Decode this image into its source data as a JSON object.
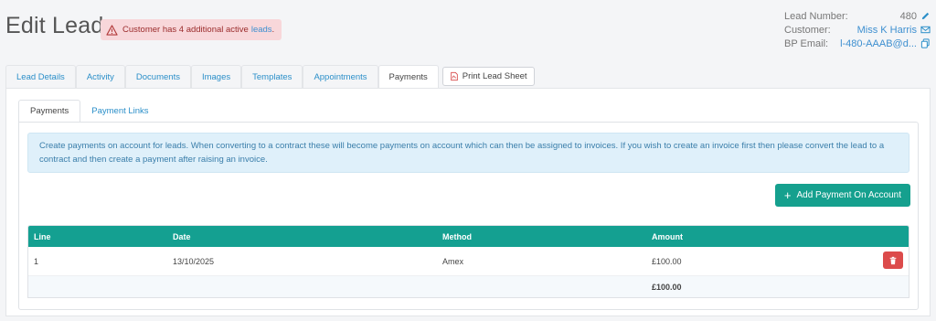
{
  "header": {
    "title": "Edit Lead",
    "alert_text": "Customer has 4 additional active",
    "alert_link": "leads",
    "alert_period": "."
  },
  "meta": {
    "lead_number_label": "Lead Number:",
    "lead_number_value": "480",
    "customer_label": "Customer:",
    "customer_value": "Miss K Harris",
    "bp_email_label": "BP Email:",
    "bp_email_value": "l-480-AAAB@d..."
  },
  "tabs": [
    {
      "label": "Lead Details"
    },
    {
      "label": "Activity"
    },
    {
      "label": "Documents"
    },
    {
      "label": "Images"
    },
    {
      "label": "Templates"
    },
    {
      "label": "Appointments"
    },
    {
      "label": "Payments"
    }
  ],
  "print_button": "Print Lead Sheet",
  "subtabs": [
    {
      "label": "Payments"
    },
    {
      "label": "Payment Links"
    }
  ],
  "info_text": "Create payments on account for leads. When converting to a contract these will become payments on account which can then be assigned to invoices. If you wish to create an invoice first then please convert the lead to a contract and then create a payment after raising an invoice.",
  "add_button": "Add Payment On Account",
  "table": {
    "headers": [
      "Line",
      "Date",
      "Method",
      "Amount"
    ],
    "rows": [
      {
        "line": "1",
        "date": "13/10/2025",
        "method": "Amex",
        "amount": "£100.00"
      }
    ],
    "total": "£100.00"
  },
  "colors": {
    "accent": "#15a08e",
    "link": "#3d8fd0",
    "danger": "#dc4b4b",
    "alert_bg": "#f8d7da"
  }
}
